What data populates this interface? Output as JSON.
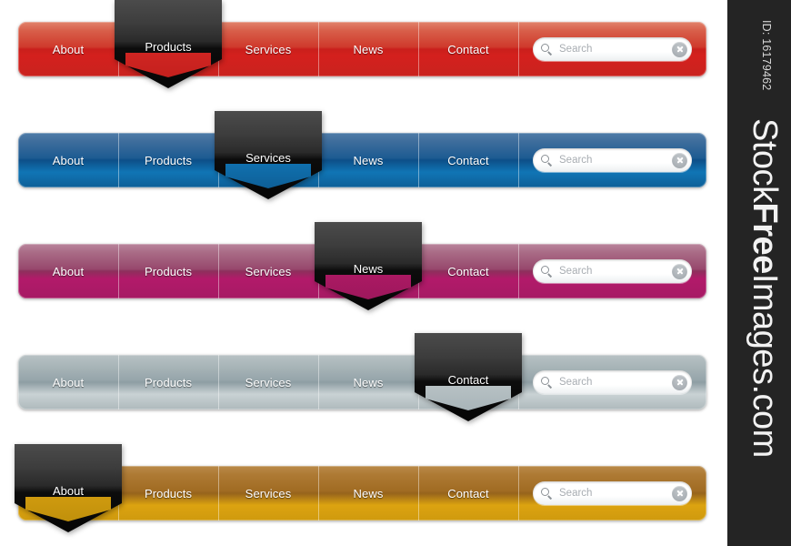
{
  "watermark": {
    "id_text": "ID: 16179462",
    "brand_prefix": "Stock",
    "brand_bold": "Free",
    "brand_suffix": "Images.com",
    "background_color": "#242424",
    "text_color": "#f2f2f2"
  },
  "search": {
    "placeholder": "Search",
    "value": "",
    "search_icon": "search-icon",
    "clear_icon": "clear-circle-icon"
  },
  "navbars": [
    {
      "theme": "red",
      "accent_color": "#c9231f",
      "active_index": 1,
      "tabs": [
        {
          "label": "About"
        },
        {
          "label": "Products"
        },
        {
          "label": "Services"
        },
        {
          "label": "News"
        },
        {
          "label": "Contact"
        }
      ]
    },
    {
      "theme": "blue",
      "accent_color": "#0e5f97",
      "active_index": 2,
      "tabs": [
        {
          "label": "About"
        },
        {
          "label": "Products"
        },
        {
          "label": "Services"
        },
        {
          "label": "News"
        },
        {
          "label": "Contact"
        }
      ]
    },
    {
      "theme": "plum",
      "accent_color": "#a61a64",
      "active_index": 3,
      "tabs": [
        {
          "label": "About"
        },
        {
          "label": "Products"
        },
        {
          "label": "Services"
        },
        {
          "label": "News"
        },
        {
          "label": "Contact"
        }
      ]
    },
    {
      "theme": "steel",
      "accent_color": "#aeb9bc",
      "active_index": 4,
      "tabs": [
        {
          "label": "About"
        },
        {
          "label": "Products"
        },
        {
          "label": "Services"
        },
        {
          "label": "News"
        },
        {
          "label": "Contact"
        }
      ]
    },
    {
      "theme": "gold",
      "accent_color": "#cf9a0e",
      "active_index": 0,
      "tabs": [
        {
          "label": "About"
        },
        {
          "label": "Products"
        },
        {
          "label": "Services"
        },
        {
          "label": "News"
        },
        {
          "label": "Contact"
        }
      ]
    }
  ],
  "layout": {
    "bar_tops": [
      24,
      146,
      268,
      390,
      512
    ]
  }
}
